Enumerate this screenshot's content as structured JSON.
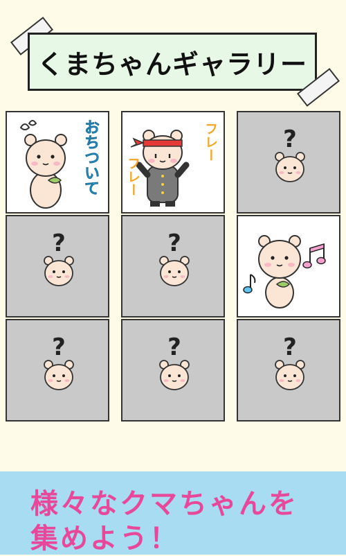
{
  "title": "くまちゃんギャラリー",
  "grid": {
    "cells": [
      {
        "state": "unlocked",
        "character": "sweating-bear",
        "label": "おちついて",
        "label_color": "#3fb4ea"
      },
      {
        "state": "unlocked",
        "character": "cheering-bear",
        "label_top": "フレー",
        "label_bottom": "フレー",
        "label_color": "#f5a623"
      },
      {
        "state": "locked",
        "mark": "?"
      },
      {
        "state": "locked",
        "mark": "?"
      },
      {
        "state": "locked",
        "mark": "?"
      },
      {
        "state": "unlocked",
        "character": "singing-bear"
      },
      {
        "state": "locked",
        "mark": "?"
      },
      {
        "state": "locked",
        "mark": "?"
      },
      {
        "state": "locked",
        "mark": "?"
      }
    ]
  },
  "promo": {
    "line1": "様々なクマちゃんを",
    "line2": "集めよう！"
  },
  "colors": {
    "background": "#fefbe9",
    "title_box": "#e8f8e6",
    "locked_cell": "#c9c9c9",
    "promo_bg": "#a8dcf2",
    "promo_text": "#e8489a",
    "bear_face": "#fbe6d6"
  }
}
